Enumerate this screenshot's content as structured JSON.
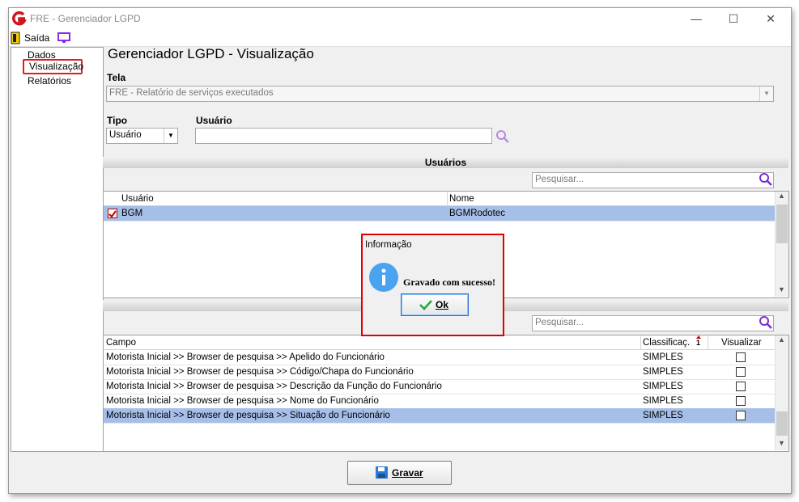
{
  "window": {
    "title": "FRE - Gerenciador LGPD",
    "minimize": "—",
    "maximize": "☐",
    "close": "✕"
  },
  "menu": {
    "exit_label": "Saída"
  },
  "sidebar": {
    "items": [
      {
        "label": "Dados"
      },
      {
        "label": "Visualização"
      },
      {
        "label": "Relatórios"
      }
    ]
  },
  "page": {
    "title": "Gerenciador LGPD - Visualização"
  },
  "tela": {
    "label": "Tela",
    "value": "FRE - Relatório de serviços executados"
  },
  "tipo": {
    "label": "Tipo",
    "value": "Usuário"
  },
  "usuario_field": {
    "label": "Usuário",
    "value": ""
  },
  "users_section": {
    "title": "Usuários",
    "search_placeholder": "Pesquisar...",
    "columns": [
      "Usuário",
      "Nome"
    ],
    "rows": [
      {
        "checked": true,
        "usuario": "BGM",
        "nome": "BGMRodotec"
      }
    ]
  },
  "fields_section": {
    "search_placeholder": "Pesquisar...",
    "columns": [
      "Campo",
      "Classificaç...",
      "Visualizar"
    ],
    "sort_indicator": "1",
    "rows": [
      {
        "campo": "Motorista Inicial >> Browser de pesquisa >> Apelido do Funcionário",
        "classificacao": "SIMPLES",
        "visualizar": false
      },
      {
        "campo": "Motorista Inicial >> Browser de pesquisa >> Código/Chapa do Funcionário",
        "classificacao": "SIMPLES",
        "visualizar": false
      },
      {
        "campo": "Motorista Inicial >> Browser de pesquisa >> Descrição da Função do Funcionário",
        "classificacao": "SIMPLES",
        "visualizar": false
      },
      {
        "campo": "Motorista Inicial >> Browser de pesquisa >> Nome do Funcionário",
        "classificacao": "SIMPLES",
        "visualizar": false
      },
      {
        "campo": "Motorista Inicial >> Browser de pesquisa >> Situação do Funcionário",
        "classificacao": "SIMPLES",
        "visualizar": false
      }
    ]
  },
  "dialog": {
    "title": "Informação",
    "message": "Gravado com sucesso!",
    "ok_label": "Ok"
  },
  "footer": {
    "save_label": "Gravar"
  },
  "colors": {
    "selection": "#a6bfe8",
    "highlight": "#e00000",
    "search_icon": "#7b2bd6",
    "info_icon": "#4aa3f0"
  }
}
